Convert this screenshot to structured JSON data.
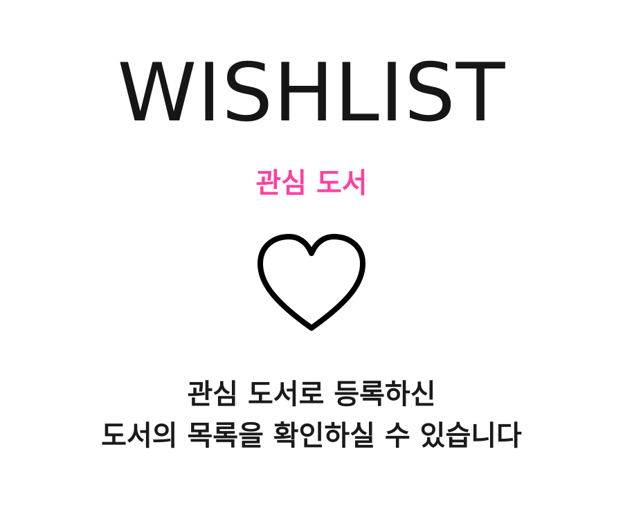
{
  "wishlist": {
    "title": "WISHLIST",
    "subtitle": "관심 도서",
    "icon": "heart-outline-icon",
    "accent_color": "#ff3fa0",
    "message_line1": "관심 도서로 등록하신",
    "message_line2": "도서의 목록을 확인하실 수 있습니다"
  }
}
